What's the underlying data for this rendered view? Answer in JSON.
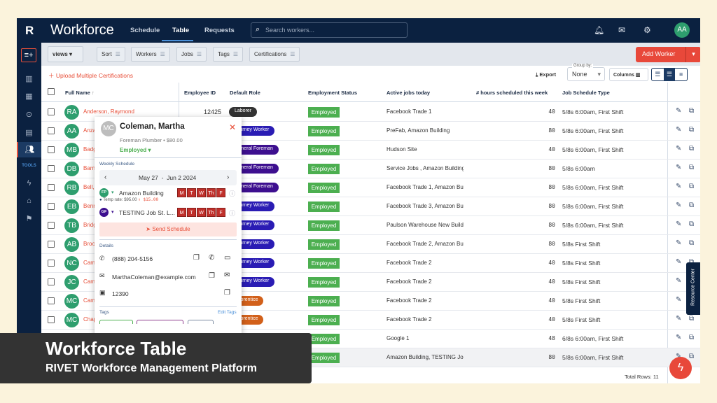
{
  "header": {
    "logo": "R",
    "title": "Workforce",
    "nav": [
      "Schedule",
      "Table",
      "Requests"
    ],
    "active_nav": "Table",
    "search_placeholder": "Search workers...",
    "avatar": "AA"
  },
  "sidebar": {
    "tools_label": "TOOLS",
    "icons": [
      "analytics-icon",
      "table-icon",
      "location-icon",
      "buildings-icon",
      "people-icon",
      "bolt-icon",
      "hardhat-icon",
      "flag-icon"
    ],
    "selected": "people-icon"
  },
  "toolbar": {
    "views": "views",
    "filters": [
      "Sort",
      "Workers",
      "Jobs",
      "Tags",
      "Certifications"
    ],
    "add_worker": "Add Worker"
  },
  "actions": {
    "upload": "Upload Multiple Certifications",
    "export": "Export",
    "group_by_label": "Group by:",
    "group_by_value": "None",
    "columns": "Columns"
  },
  "columns": [
    "Full Name",
    "Employee ID",
    "Default Role",
    "Employment Status",
    "Active jobs today",
    "# hours scheduled this week",
    "Job Schedule Type"
  ],
  "role_colors": {
    "Laborer": "#333333",
    "Journey Worker": "#2a1cb4",
    "General Foreman": "#3d0f8f",
    "Apprentice": "#d2601a"
  },
  "rows": [
    {
      "initials": "RA",
      "name": "Anderson, Raymond",
      "id": "12425",
      "role": "Laborer",
      "status": "Employed",
      "jobs": "Facebook Trade 1",
      "hours": "40",
      "schedule": "5/8s 6:00am, First Shift"
    },
    {
      "initials": "AA",
      "name": "Anza",
      "id": "",
      "role": "Journey Worker",
      "status": "Employed",
      "jobs": "PreFab, Amazon Building",
      "hours": "80",
      "schedule": "5/8s 6:00am, First Shift"
    },
    {
      "initials": "MB",
      "name": "Badg",
      "id": "",
      "role": "General Foreman",
      "status": "Employed",
      "jobs": "Hudson Site",
      "hours": "40",
      "schedule": "5/8s 6:00am, First Shift"
    },
    {
      "initials": "DB",
      "name": "Barn",
      "id": "",
      "role": "General Foreman",
      "status": "Employed",
      "jobs": "Service Jobs , Amazon Building",
      "hours": "80",
      "schedule": "5/8s 6:00am"
    },
    {
      "initials": "RB",
      "name": "Bell,",
      "id": "",
      "role": "General Foreman",
      "status": "Employed",
      "jobs": "Facebook Trade 1, Amazon Bui",
      "hours": "80",
      "schedule": "5/8s 6:00am, First Shift"
    },
    {
      "initials": "EB",
      "name": "Benn",
      "id": "",
      "role": "Journey Worker",
      "status": "Employed",
      "jobs": "Facebook Trade 3, Amazon Bui",
      "hours": "80",
      "schedule": "5/8s 6:00am, First Shift"
    },
    {
      "initials": "TB",
      "name": "Bridg",
      "id": "",
      "role": "Journey Worker",
      "status": "Employed",
      "jobs": "Paulson Warehouse New Build,",
      "hours": "80",
      "schedule": "5/8s 6:00am, First Shift"
    },
    {
      "initials": "AB",
      "name": "Broo",
      "id": "",
      "role": "Journey Worker",
      "status": "Employed",
      "jobs": "Facebook Trade 2, Amazon Bui",
      "hours": "80",
      "schedule": "5/8s First Shift"
    },
    {
      "initials": "NC",
      "name": "Cam",
      "id": "",
      "role": "Journey Worker",
      "status": "Employed",
      "jobs": "Facebook Trade 2",
      "hours": "40",
      "schedule": "5/8s First Shift"
    },
    {
      "initials": "JC",
      "name": "Cam",
      "id": "",
      "role": "Journey Worker",
      "status": "Employed",
      "jobs": "Facebook Trade 2",
      "hours": "40",
      "schedule": "5/8s First Shift"
    },
    {
      "initials": "MC",
      "name": "Cam",
      "id": "",
      "role": "Apprentice",
      "status": "Employed",
      "jobs": "Facebook Trade 2",
      "hours": "40",
      "schedule": "5/8s First Shift"
    },
    {
      "initials": "MC",
      "name": "Chap",
      "id": "",
      "role": "Apprentice",
      "status": "Employed",
      "jobs": "Facebook Trade 2",
      "hours": "40",
      "schedule": "5/8s First Shift"
    },
    {
      "initials": "",
      "name": "",
      "id": "",
      "role": "",
      "status": "Employed",
      "jobs": "Google 1",
      "hours": "48",
      "schedule": "6/8s 6:00am, First Shift"
    },
    {
      "initials": "",
      "name": "",
      "id": "",
      "role": "",
      "status": "Employed",
      "jobs": "Amazon Building, TESTING Job",
      "hours": "80",
      "schedule": "5/8s 6:00am, First Shift"
    }
  ],
  "footer": {
    "total": "Total Rows: 11"
  },
  "popup": {
    "initials": "MC",
    "name": "Coleman, Martha",
    "subtitle": "Foreman Plumber • $80.00",
    "status": "Employed",
    "weekly_label": "Weekly Schedule",
    "week": "May 27  -  Jun 2 2024",
    "jobs": [
      {
        "badge": "FP",
        "badge_color": "#2e9e6e",
        "name": "Amazon Building",
        "days": [
          "M",
          "T",
          "W",
          "Th",
          "F"
        ]
      },
      {
        "badge": "GF",
        "badge_color": "#3d0f8f",
        "name": "TESTING Job St. L...",
        "days": [
          "M",
          "T",
          "W",
          "Th",
          "F"
        ]
      }
    ],
    "temp_rate": "Temp rate: $95.00",
    "rate_delta": "↑ $15.00",
    "send": "Send Schedule",
    "details_label": "Details",
    "phone": "(888) 204-5156",
    "email": "MarthaColeman@example.com",
    "employee_id": "12390",
    "tags_label": "Tags",
    "edit_tags": "Edit Tags"
  },
  "resource_center": "Resource Center",
  "banner": {
    "title": "Workforce Table",
    "subtitle": "RIVET Workforce Management Platform"
  }
}
